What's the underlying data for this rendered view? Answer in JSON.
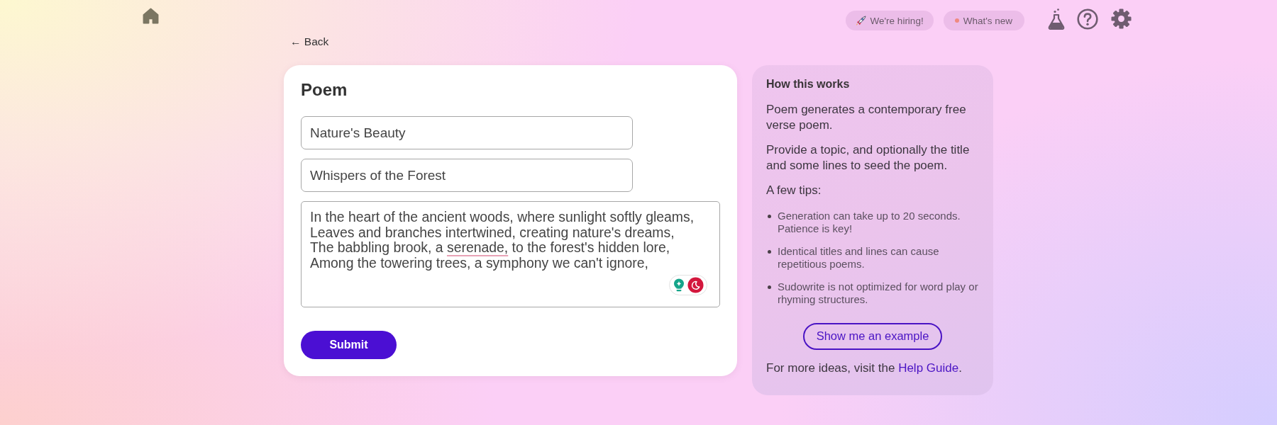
{
  "header": {
    "pills": [
      {
        "kind": "hiring",
        "label": "We're hiring!"
      },
      {
        "kind": "news",
        "label": "What's new"
      }
    ]
  },
  "back": {
    "label": "← Back"
  },
  "form": {
    "title": "Poem",
    "fields": [
      {
        "value": "Nature's Beauty"
      },
      {
        "value": "Whispers of the Forest"
      }
    ],
    "poem_text": [
      {
        "text": "In the heart of the ancient woods, where sunlight softly gleams,\nLeaves and branches intertwined, creating nature's dreams,\nThe babbling brook, a ",
        "misspelled": false
      },
      {
        "text": "serenade,",
        "misspelled": true
      },
      {
        "text": " to the forest's hidden lore,\nAmong the towering trees, a symphony we can't ignore,",
        "misspelled": false
      }
    ],
    "submit": "Submit"
  },
  "help": {
    "heading": "How this works",
    "paragraphs": [
      "Poem generates a contemporary free verse poem.",
      "Provide a topic, and optionally the title and some lines to seed the poem."
    ],
    "tips_heading": "A few tips:",
    "tips": [
      "Generation can take up to 20 seconds. Patience is key!",
      "Identical titles and lines can cause repetitious poems.",
      "Sudowrite is not optimized for word play or rhyming structures."
    ],
    "example_button": "Show me an example",
    "footer": {
      "before": "For more ideas, visit the ",
      "link": "Help Guide",
      "after": "."
    }
  }
}
